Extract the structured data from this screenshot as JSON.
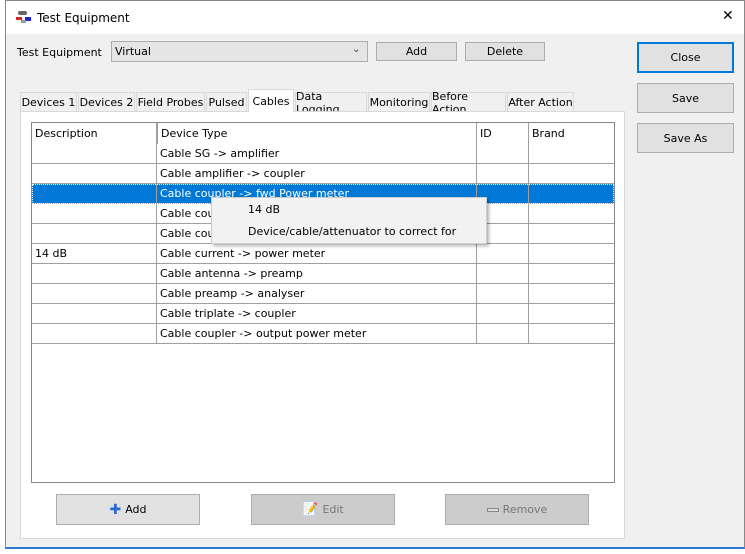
{
  "window": {
    "title": "Test Equipment",
    "close_glyph": "✕"
  },
  "top": {
    "label": "Test Equipment",
    "combo_value": "Virtual",
    "add": "Add",
    "delete": "Delete"
  },
  "side": {
    "close": "Close",
    "save": "Save",
    "save_as": "Save As"
  },
  "tabs": [
    "Devices 1",
    "Devices 2",
    "Field Probes",
    "Pulsed",
    "Cables",
    "Data Logging",
    "Monitoring",
    "Before Action",
    "After Action"
  ],
  "selected_tab": "Cables",
  "grid": {
    "columns": [
      "Description",
      "Device Type",
      "ID",
      "Brand"
    ],
    "rows": [
      {
        "description": "",
        "device_type": "Cable SG -> amplifier",
        "id": "",
        "brand": ""
      },
      {
        "description": "",
        "device_type": "Cable amplifier -> coupler",
        "id": "",
        "brand": ""
      },
      {
        "description": "",
        "device_type": "Cable coupler -> fwd Power meter",
        "id": "",
        "brand": ""
      },
      {
        "description": "",
        "device_type": "Cable coupler -> rfl Power meter",
        "id": "",
        "brand": ""
      },
      {
        "description": "",
        "device_type": "Cable coupler -> output",
        "id": "",
        "brand": ""
      },
      {
        "description": "14 dB",
        "device_type": "Cable current -> power meter",
        "id": "",
        "brand": ""
      },
      {
        "description": "",
        "device_type": "Cable antenna -> preamp",
        "id": "",
        "brand": ""
      },
      {
        "description": "",
        "device_type": "Cable preamp -> analyser",
        "id": "",
        "brand": ""
      },
      {
        "description": "",
        "device_type": "Cable triplate -> coupler",
        "id": "",
        "brand": ""
      },
      {
        "description": "",
        "device_type": "Cable coupler -> output power meter",
        "id": "",
        "brand": ""
      }
    ],
    "selected_row": 2
  },
  "context_menu": [
    "14 dB",
    "Device/cable/attenuator to correct for"
  ],
  "bottom": {
    "add": "Add",
    "edit": "Edit",
    "remove": "Remove"
  },
  "colors": {
    "selection": "#0078d7",
    "accent_border": "#0078d7"
  }
}
